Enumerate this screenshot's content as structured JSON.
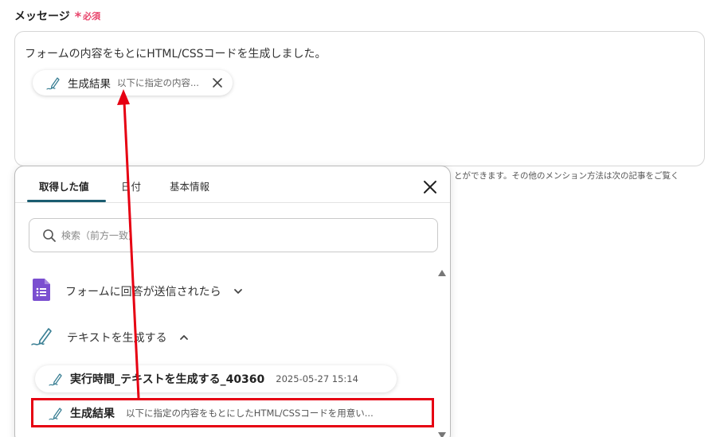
{
  "field": {
    "label": "メッセージ",
    "required_mark": "*",
    "required_text": "必須",
    "message_text": "フォームの内容をもとにHTML/CSSコードを生成しました。",
    "chip": {
      "title": "生成結果",
      "subtitle": "以下に指定の内容...",
      "icon": "pen-icon"
    },
    "help_text": "とができます。その他のメンション方法は次の記事をご覧く"
  },
  "popover": {
    "tabs": [
      {
        "label": "取得した値",
        "active": true
      },
      {
        "label": "日付",
        "active": false
      },
      {
        "label": "基本情報",
        "active": false
      }
    ],
    "search_placeholder": "検索（前方一致）",
    "groups": [
      {
        "label": "フォームに回答が送信されたら",
        "icon": "google-forms-icon",
        "expanded": false
      },
      {
        "label": "テキストを生成する",
        "icon": "pen-icon",
        "expanded": true
      }
    ],
    "items": [
      {
        "title": "実行時間_テキストを生成する_40360",
        "subtitle": "2025-05-27 15:14"
      },
      {
        "title": "生成結果",
        "subtitle": "以下に指定の内容をもとにしたHTML/CSSコードを用意い..."
      }
    ]
  },
  "colors": {
    "required": "#e8446b",
    "tab_underline": "#1a5c70",
    "annotation_red": "#e60012",
    "forms_purple": "#7b4fd0",
    "pen_teal": "#3a7f94"
  }
}
